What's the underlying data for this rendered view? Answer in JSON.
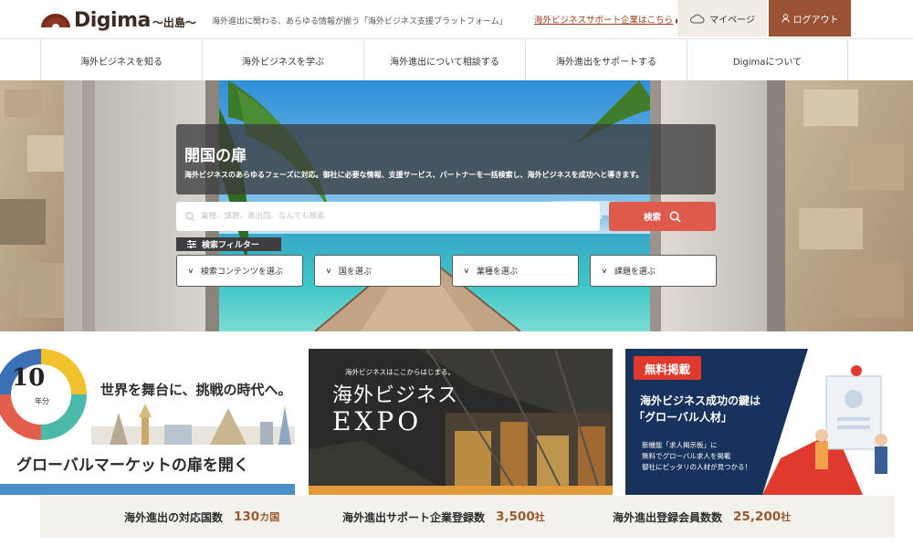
{
  "header": {
    "logo_text": "Digima",
    "logo_sub": "〜出島〜",
    "tagline": "海外進出に関わる、あらゆる情報が揃う「海外ビジネス支援プラットフォーム」",
    "support_link": "海外ビジネスサポート企業はこちら",
    "mypage_label": "マイページ",
    "logout_label": "ログアウト"
  },
  "nav": {
    "items": [
      {
        "label": "海外ビジネスを知る"
      },
      {
        "label": "海外ビジネスを学ぶ"
      },
      {
        "label": "海外進出について相談する"
      },
      {
        "label": "海外進出をサポートする"
      },
      {
        "label": "Digimaについて"
      }
    ]
  },
  "hero": {
    "title": "開国の扉",
    "description": "海外ビジネスのあらゆるフェーズに対応。御社に必要な情報、支援サービス、パートナーを一括検索し、海外ビジネスを成功へと導きます。",
    "search_placeholder": "業種、課題、進出国、なんでも検索",
    "search_button": "検索",
    "filter_label": "検索フィルター",
    "filters": [
      {
        "label": "検索コンテンツを選ぶ"
      },
      {
        "label": "国を選ぶ"
      },
      {
        "label": "業種を選ぶ"
      },
      {
        "label": "課題を選ぶ"
      }
    ]
  },
  "banners": {
    "b1": {
      "num": "10",
      "unit": "年分",
      "catch": "世界を舞台に、挑戦の時代へ。",
      "main": "グローバルマーケットの扉を開く"
    },
    "b2": {
      "tag": "海外ビジネスはここからはじまる。",
      "title": "海外ビジネス",
      "expo": "EXPO"
    },
    "b3": {
      "badge": "無料掲載",
      "head1": "海外ビジネス成功の鍵は",
      "head2": "「グローバル人材」",
      "line1": "新機能「求人掲示板」に",
      "line2": "無料でグローバル求人を掲載",
      "line3": "御社にピッタリの人材が見つかる！"
    }
  },
  "stats": [
    {
      "label": "海外進出の対応国数",
      "value": "130",
      "unit": "カ国"
    },
    {
      "label": "海外進出サポート企業登録数",
      "value": "3,500",
      "unit": "社"
    },
    {
      "label": "海外進出登録会員数数",
      "value": "25,200",
      "unit": "社"
    }
  ],
  "colors": {
    "accent_brown": "#9a5234",
    "search_red": "#df5a4a",
    "link_red": "#9c3b1c",
    "stat_number": "#9a5a30",
    "badge_red": "#e03a2e"
  },
  "icons": {
    "logo": "fan-logo-icon",
    "mypage": "cloud-icon",
    "logout": "user-icon",
    "search": "search-icon",
    "filter": "sliders-icon",
    "dropdown": "chevron-down-icon"
  }
}
